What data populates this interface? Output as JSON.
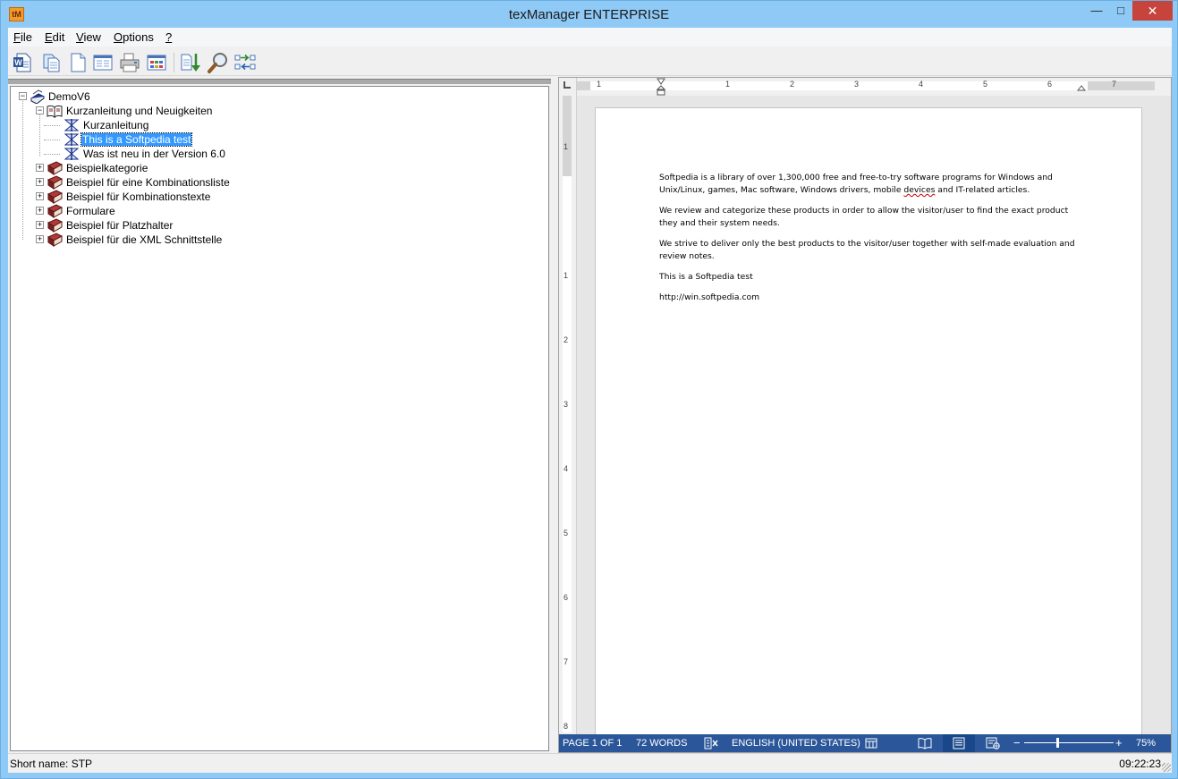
{
  "window": {
    "title": "texManager ENTERPRISE",
    "app_icon_text": "tM",
    "minimize_glyph": "—",
    "maximize_glyph": "□",
    "close_glyph": "✕"
  },
  "menu": {
    "items": [
      {
        "label": "File",
        "accel": "F",
        "rest": "ile"
      },
      {
        "label": "Edit",
        "accel": "E",
        "rest": "dit"
      },
      {
        "label": "View",
        "accel": "V",
        "rest": "iew"
      },
      {
        "label": "Options",
        "accel": "O",
        "rest": "ptions"
      },
      {
        "label": "?",
        "accel": "?",
        "rest": ""
      }
    ]
  },
  "toolbar": {
    "buttons": [
      {
        "icon": "word-document-icon"
      },
      {
        "icon": "copy-document-icon"
      },
      {
        "icon": "blank-document-icon"
      },
      {
        "icon": "form-window-icon"
      },
      {
        "icon": "printer-icon"
      },
      {
        "icon": "table-grid-icon"
      },
      {
        "icon": "sort-down-icon"
      },
      {
        "icon": "magnifier-icon"
      },
      {
        "icon": "sync-arrows-icon"
      }
    ]
  },
  "tree": {
    "root": "DemoV6",
    "items": [
      {
        "label": "Kurzanleitung und Neuigkeiten",
        "level": 1,
        "expanded": true,
        "icon": "open-book-icon"
      },
      {
        "label": "Kurzanleitung",
        "level": 2,
        "icon": "text-entry-icon"
      },
      {
        "label": "This is a Softpedia test",
        "level": 2,
        "icon": "text-entry-icon",
        "selected": true
      },
      {
        "label": "Was ist neu in der Version 6.0",
        "level": 2,
        "icon": "text-entry-icon"
      },
      {
        "label": "Beispielkategorie",
        "level": 1,
        "icon": "closed-book-icon"
      },
      {
        "label": "Beispiel für eine Kombinationsliste",
        "level": 1,
        "icon": "closed-book-icon"
      },
      {
        "label": "Beispiel für Kombinationstexte",
        "level": 1,
        "icon": "closed-book-icon"
      },
      {
        "label": "Formulare",
        "level": 1,
        "icon": "closed-book-icon"
      },
      {
        "label": "Beispiel für Platzhalter",
        "level": 1,
        "icon": "closed-book-icon"
      },
      {
        "label": "Beispiel für die XML Schnittstelle",
        "level": 1,
        "icon": "closed-book-icon"
      }
    ]
  },
  "ruler": {
    "h_numbers": [
      "1",
      "1",
      "2",
      "3",
      "4",
      "5",
      "6",
      "7"
    ],
    "v_numbers": [
      "1",
      "1",
      "2",
      "3",
      "4",
      "5",
      "6",
      "7",
      "8"
    ]
  },
  "document": {
    "paragraphs": [
      {
        "before": "Softpedia is a library of over 1,300,000 free and free-to-try software programs for Windows and Unix/Linux, games, Mac software, Windows drivers, mobile ",
        "squiggle": "devices",
        "after": " and IT-related articles."
      },
      {
        "before": "We review and categorize these products in order to allow the visitor/user to find the exact product they and their system needs.",
        "squiggle": "",
        "after": ""
      },
      {
        "before": "We strive to deliver only the best products to the visitor/user together with self-made evaluation and review notes.",
        "squiggle": "",
        "after": ""
      },
      {
        "before": "This is a Softpedia test",
        "squiggle": "",
        "after": ""
      },
      {
        "before": "http://win.softpedia.com",
        "squiggle": "",
        "after": ""
      }
    ]
  },
  "word_status": {
    "page": "PAGE 1 OF 1",
    "words": "72 WORDS",
    "language": "ENGLISH (UNITED STATES)",
    "zoom_minus": "−",
    "zoom_plus": "+",
    "zoom": "75%",
    "zoom_fraction": 0.37
  },
  "status": {
    "short_name": "Short name: STP",
    "time": "09:22:23"
  },
  "colors": {
    "titlebar": "#8fc9f5",
    "close_button": "#c7443d",
    "word_status_bar": "#2b579a",
    "selection": "#3399ff"
  }
}
